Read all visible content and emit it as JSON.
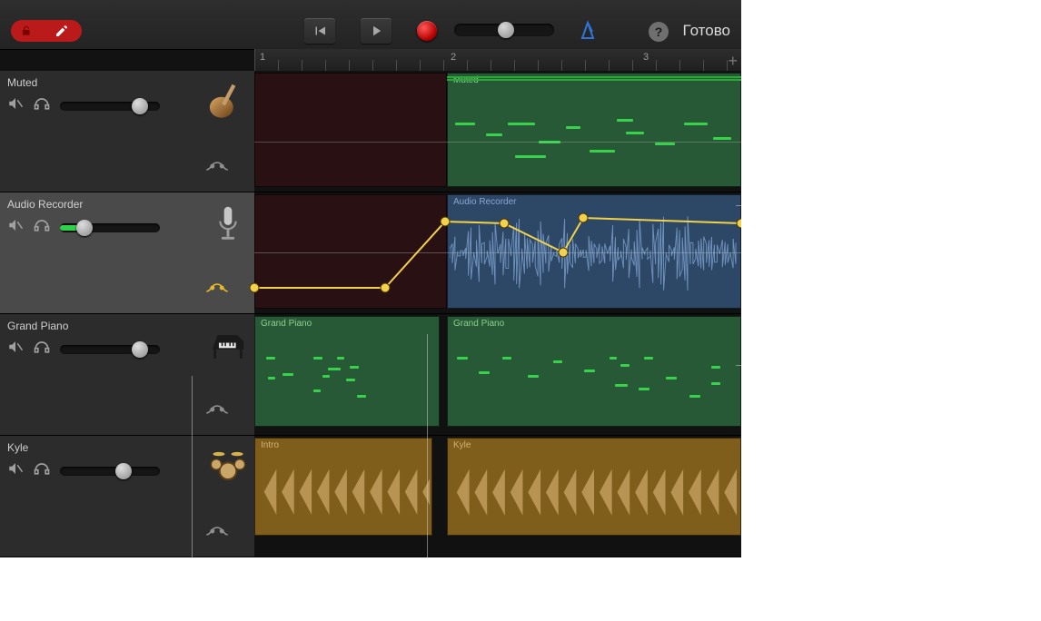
{
  "toolbar": {
    "done_label": "Готово",
    "help_glyph": "?",
    "edit_mode": "pencil"
  },
  "ruler": {
    "bars": [
      "1",
      "2",
      "3"
    ]
  },
  "tracks": [
    {
      "name": "Muted",
      "selected": false,
      "volume": 0.72,
      "level": 0,
      "automation_active": false,
      "instrument": "bass-guitar-icon",
      "regions": [
        {
          "label": "",
          "start": 0,
          "len": 212,
          "style": "dkred",
          "midi": []
        },
        {
          "label": "Muted",
          "start": 212,
          "len": 324,
          "style": "green",
          "midi": [
            [
              8,
              40,
              22
            ],
            [
              42,
              52,
              18
            ],
            [
              66,
              40,
              30
            ],
            [
              100,
              60,
              24
            ],
            [
              130,
              44,
              16
            ],
            [
              156,
              70,
              28
            ],
            [
              196,
              50,
              20
            ],
            [
              228,
              62,
              22
            ],
            [
              260,
              40,
              26
            ],
            [
              292,
              56,
              20
            ],
            [
              74,
              76,
              34
            ],
            [
              186,
              36,
              18
            ]
          ]
        }
      ]
    },
    {
      "name": "Audio Recorder",
      "selected": true,
      "volume": 0.16,
      "level": 0.18,
      "automation_active": true,
      "instrument": "microphone-icon",
      "regions": [
        {
          "label": "",
          "start": 0,
          "len": 212,
          "style": "dkred",
          "midi": []
        },
        {
          "label": "Audio Recorder",
          "start": 212,
          "len": 324,
          "style": "blue",
          "waveform": true
        }
      ],
      "automation_points": [
        [
          0,
          85
        ],
        [
          144,
          85
        ],
        [
          210,
          12
        ],
        [
          275,
          14
        ],
        [
          340,
          46
        ],
        [
          362,
          8
        ],
        [
          536,
          14
        ]
      ]
    },
    {
      "name": "Grand Piano",
      "selected": false,
      "volume": 0.72,
      "level": 0,
      "automation_active": false,
      "instrument": "piano-icon",
      "regions": [
        {
          "label": "Grand Piano",
          "start": 0,
          "len": 204,
          "style": "green",
          "midi": [
            [
              12,
              30,
              10
            ],
            [
              30,
              48,
              12
            ],
            [
              64,
              30,
              10
            ],
            [
              64,
              66,
              8
            ],
            [
              80,
              42,
              14
            ],
            [
              100,
              54,
              10
            ],
            [
              112,
              72,
              10
            ],
            [
              90,
              30,
              8
            ],
            [
              104,
              40,
              10
            ],
            [
              74,
              50,
              8
            ],
            [
              14,
              52,
              8
            ]
          ]
        },
        {
          "label": "Grand Piano",
          "start": 212,
          "len": 324,
          "style": "green",
          "midi": [
            [
              10,
              30,
              12
            ],
            [
              34,
              46,
              12
            ],
            [
              60,
              30,
              10
            ],
            [
              88,
              50,
              12
            ],
            [
              116,
              34,
              10
            ],
            [
              150,
              44,
              12
            ],
            [
              184,
              60,
              14
            ],
            [
              216,
              30,
              10
            ],
            [
              240,
              52,
              12
            ],
            [
              266,
              72,
              12
            ],
            [
              290,
              40,
              10
            ],
            [
              290,
              58,
              10
            ],
            [
              190,
              38,
              10
            ],
            [
              210,
              64,
              12
            ],
            [
              178,
              30,
              8
            ]
          ]
        }
      ]
    },
    {
      "name": "Kyle",
      "selected": false,
      "volume": 0.55,
      "level": 0,
      "automation_active": false,
      "instrument": "drumkit-icon",
      "regions": [
        {
          "label": "Intro",
          "start": 0,
          "len": 196,
          "style": "amb",
          "drums": true
        },
        {
          "label": "Kyle",
          "start": 212,
          "len": 324,
          "style": "amb",
          "drums": true
        }
      ]
    }
  ]
}
